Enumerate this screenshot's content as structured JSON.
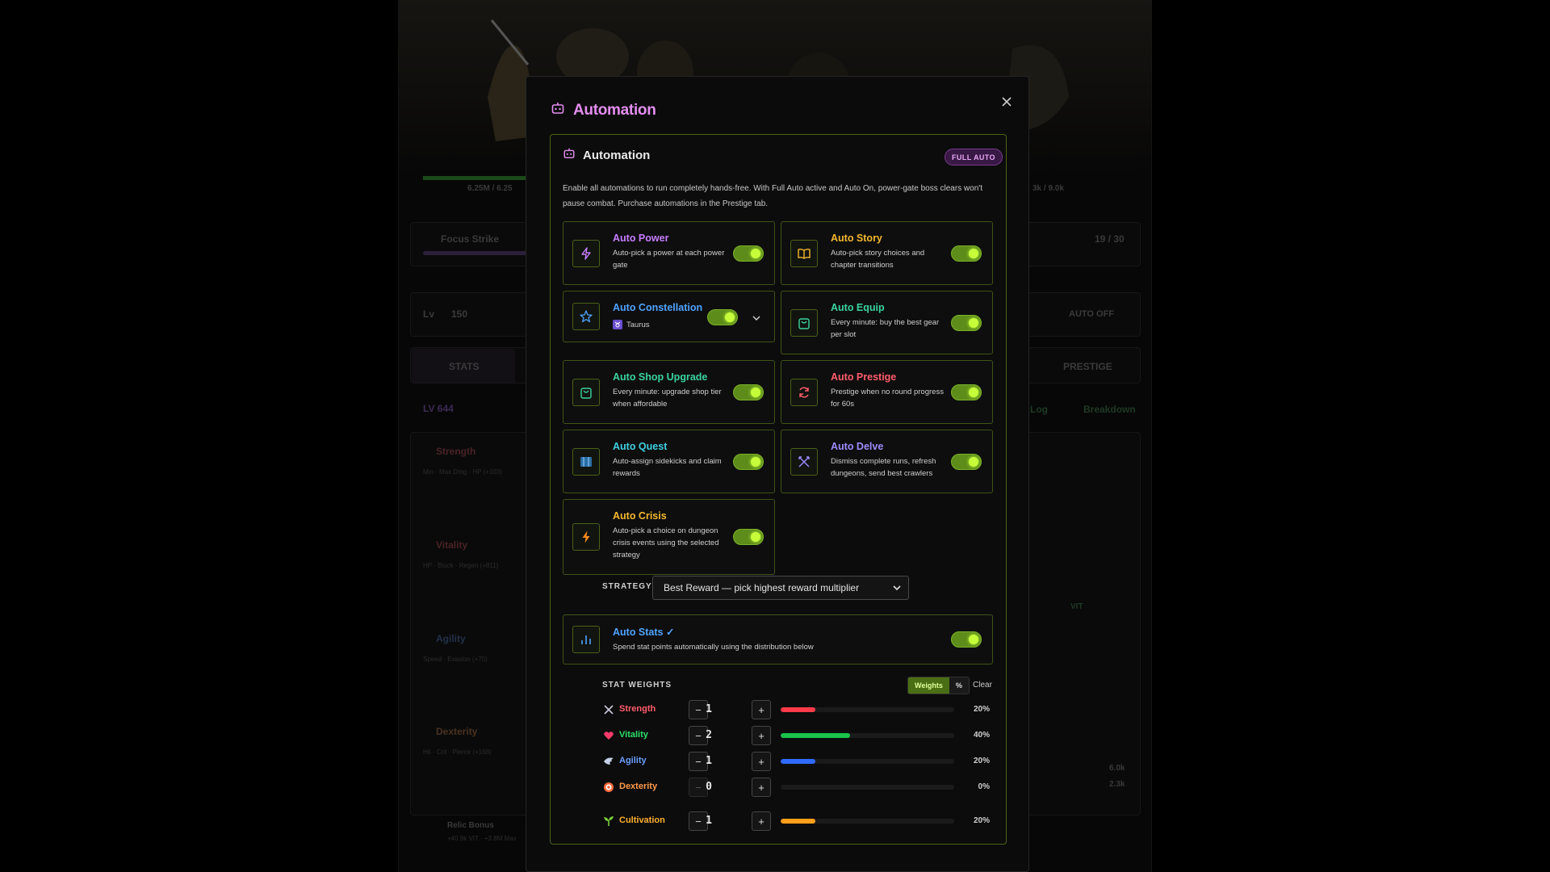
{
  "modal": {
    "title": "Automation",
    "close_icon": "close-icon"
  },
  "panel": {
    "title": "Automation",
    "badge": "FULL AUTO",
    "description": "Enable all automations to run completely hands-free. With Full Auto active and Auto On, power-gate boss clears won't pause combat. Purchase automations in the Prestige tab."
  },
  "automations": {
    "power": {
      "name": "Auto Power",
      "desc": "Auto-pick a power at each power gate",
      "color": "#c77dff",
      "on": true,
      "icon": "lightning-icon"
    },
    "story": {
      "name": "Auto Story",
      "desc": "Auto-pick story choices and chapter transitions",
      "color": "#f5b82e",
      "on": true,
      "icon": "book-icon"
    },
    "constellation": {
      "name": "Auto Constellation",
      "selected": "Taurus",
      "color": "#4fa3ff",
      "on": true,
      "icon": "star-icon"
    },
    "equip": {
      "name": "Auto Equip",
      "desc": "Every minute: buy the best gear per slot",
      "color": "#3ad3a0",
      "on": true,
      "icon": "bag-icon"
    },
    "shop": {
      "name": "Auto Shop Upgrade",
      "desc": "Every minute: upgrade shop tier when affordable",
      "color": "#3ad3a0",
      "on": true,
      "icon": "bag-icon"
    },
    "prestige": {
      "name": "Auto Prestige",
      "desc": "Prestige when no round progress for 60s",
      "color": "#ff5d6c",
      "on": true,
      "icon": "refresh-icon"
    },
    "quest": {
      "name": "Auto Quest",
      "desc": "Auto-assign sidekicks and claim rewards",
      "color": "#3ecfe0",
      "on": true,
      "icon": "map-icon"
    },
    "delve": {
      "name": "Auto Delve",
      "desc": "Dismiss complete runs, refresh dungeons, send best crawlers",
      "color": "#9f8bff",
      "on": true,
      "icon": "crossed-swords-icon"
    },
    "crisis": {
      "name": "Auto Crisis",
      "desc": "Auto-pick a choice on dungeon crisis events using the selected strategy",
      "color": "#f5b82e",
      "on": true,
      "icon": "bolt-icon"
    },
    "stats": {
      "name": "Auto Stats ✓",
      "desc": "Spend stat points automatically using the distribution below",
      "color": "#4fa3ff",
      "on": true,
      "icon": "bar-chart-icon"
    }
  },
  "strategy": {
    "label": "STRATEGY",
    "value": "Best Reward — pick highest reward multiplier"
  },
  "stat_weights": {
    "label": "STAT WEIGHTS",
    "mode_weights": "Weights",
    "mode_percent": "%",
    "clear": "Clear",
    "rows": [
      {
        "name": "Strength",
        "value": "1",
        "pct": "20%",
        "fraction": 0.2,
        "color": "#ff3b4a",
        "name_color": "#ff5d6c"
      },
      {
        "name": "Vitality",
        "value": "2",
        "pct": "40%",
        "fraction": 0.4,
        "color": "#19c24a",
        "name_color": "#2ee06a"
      },
      {
        "name": "Agility",
        "value": "1",
        "pct": "20%",
        "fraction": 0.2,
        "color": "#2f6bff",
        "name_color": "#6aa0ff"
      },
      {
        "name": "Dexterity",
        "value": "0",
        "pct": "0%",
        "fraction": 0,
        "color": "#ff8a3d",
        "name_color": "#ff9a4a"
      },
      {
        "name": "Cultivation",
        "value": "1",
        "pct": "20%",
        "fraction": 0.2,
        "color": "#ff9f1a",
        "name_color": "#ffb12e"
      }
    ]
  },
  "background": {
    "hp_left": "6.25M / 6.25",
    "hp_right": "3k / 9.0k",
    "focus": "Focus Strike",
    "focus_count": "19 / 30",
    "lv_label": "Lv",
    "lv_value": "150",
    "auto_off": "AUTO OFF",
    "tab_stats": "STATS",
    "tab_prestige": "PRESTIGE",
    "lv_badge": "LV 644",
    "log": "Log",
    "breakdown": "Breakdown",
    "stat_names": [
      "Strength",
      "Vitality",
      "Agility",
      "Dexterity"
    ],
    "stat_subs": [
      "Min · Max Dmg · HP (+103)",
      "HP · Block · Regen (+811)",
      "Speed · Evasion (+75)",
      "Hit · Crit · Pierce (+168)"
    ],
    "relic": "Relic Bonus",
    "relic_sub": "+40.9k VIT · +3.8M Max",
    "vit_label": "VIT",
    "val_a": "6.0k",
    "val_b": "2.3k"
  }
}
